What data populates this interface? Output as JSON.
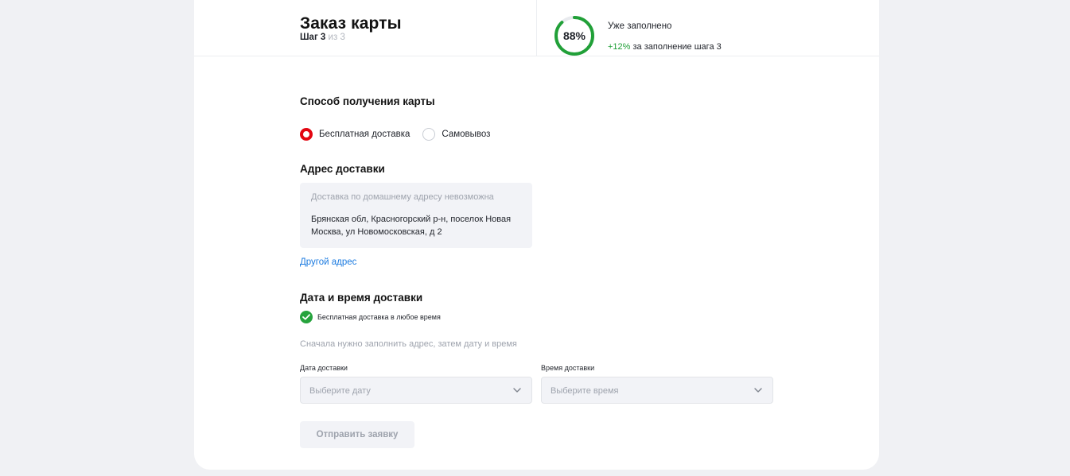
{
  "header": {
    "title": "Заказ карты",
    "step_current": "Шаг 3",
    "step_total": "из 3",
    "progress_value": "88%",
    "progress_fraction": 0.88,
    "filled_title": "Уже заполнено",
    "filled_plus": "+12%",
    "filled_sub": "за заполнение шага 3"
  },
  "delivery_method": {
    "title": "Способ получения карты",
    "options": [
      {
        "label": "Бесплатная доставка",
        "checked": true
      },
      {
        "label": "Самовывоз",
        "checked": false
      }
    ]
  },
  "address": {
    "title": "Адрес доставки",
    "note": "Доставка по домашнему адресу невозможна",
    "value": "Брянская обл, Красногорский р-н, поселок Новая Москва, ул Новомосковская, д 2",
    "other_link": "Другой адрес"
  },
  "datetime": {
    "title": "Дата и время доставки",
    "free_badge": "Бесплатная доставка в любое время",
    "hint": "Сначала нужно заполнить адрес, затем дату и время",
    "date_label": "Дата доставки",
    "date_placeholder": "Выберите дату",
    "time_label": "Время доставки",
    "time_placeholder": "Выберите время"
  },
  "submit_label": "Отправить заявку",
  "colors": {
    "accent_red": "#e30611",
    "success_green": "#21a038",
    "link_blue": "#1a7ae0"
  }
}
